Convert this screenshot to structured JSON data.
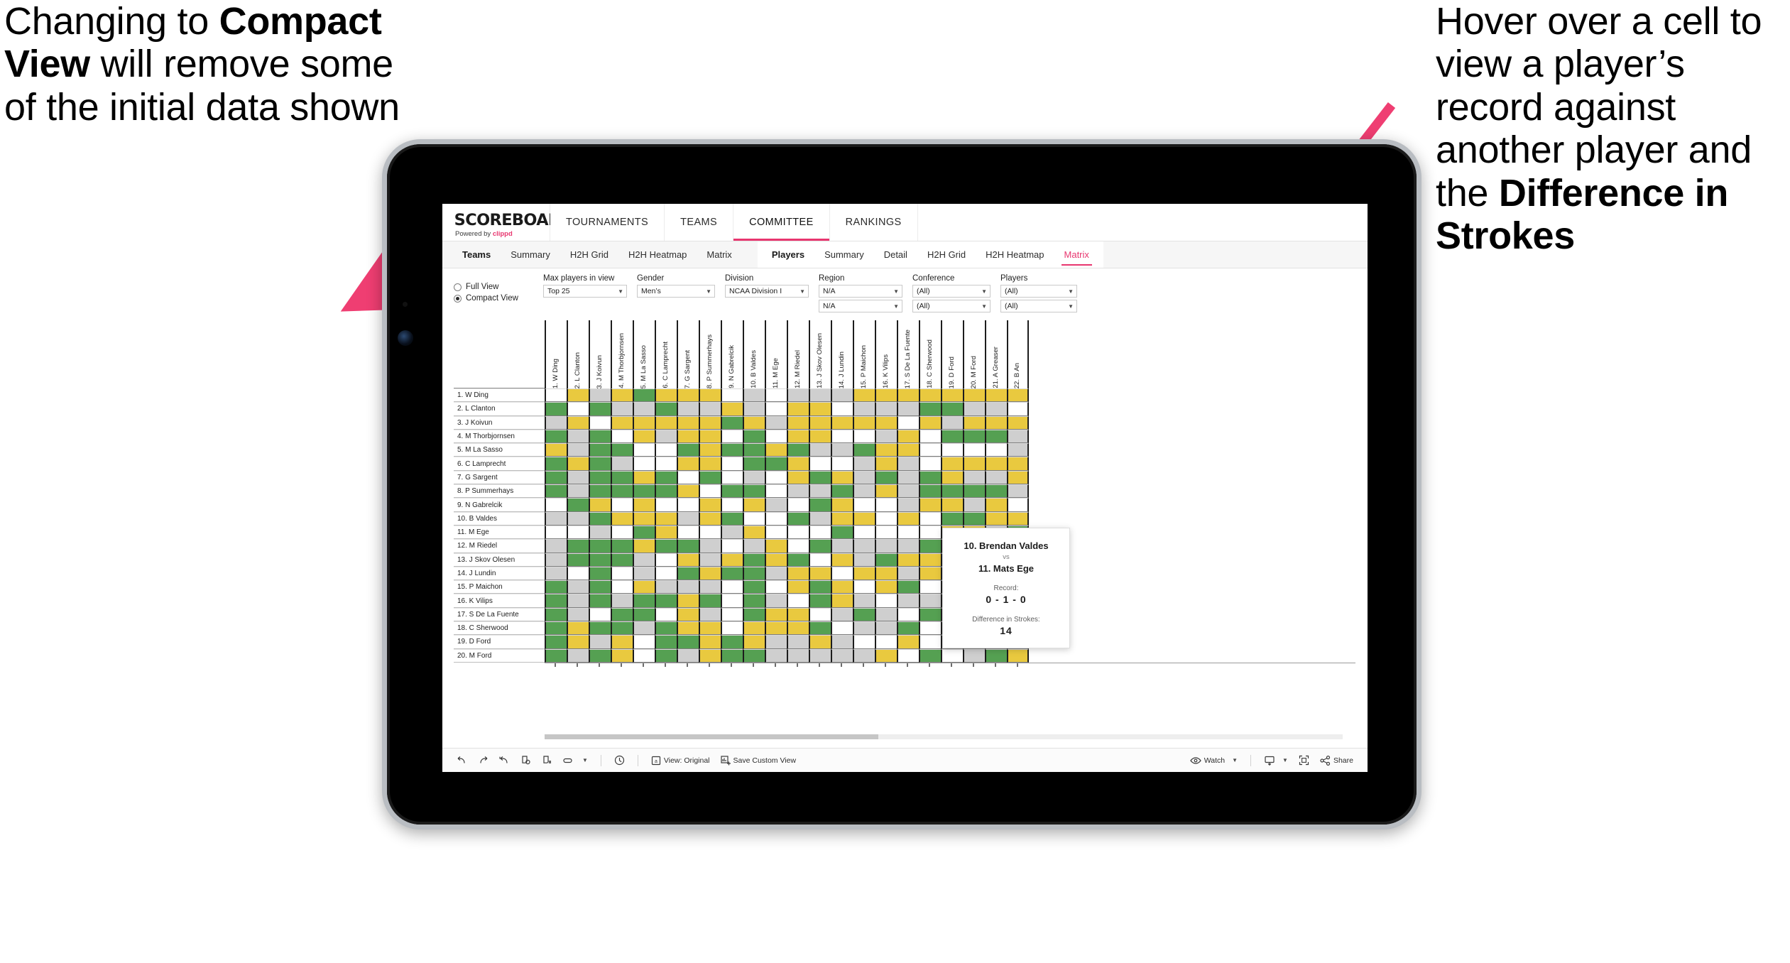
{
  "annotations": {
    "left": {
      "pre": "Changing to ",
      "bold": "Compact View",
      "post": " will remove some of the initial data shown"
    },
    "right": {
      "pre": "Hover over a cell to view a player’s record against another player and the ",
      "bold": "Difference in Strokes",
      "post": ""
    }
  },
  "brand": {
    "title": "SCOREBOARD",
    "powered_prefix": "Powered by ",
    "powered_name": "clippd"
  },
  "topnav": [
    {
      "label": "TOURNAMENTS",
      "active": false
    },
    {
      "label": "TEAMS",
      "active": false
    },
    {
      "label": "COMMITTEE",
      "active": true
    },
    {
      "label": "RANKINGS",
      "active": false
    }
  ],
  "subnav": {
    "group1": [
      {
        "label": "Teams",
        "head": true,
        "active": false
      },
      {
        "label": "Summary",
        "head": false,
        "active": false
      },
      {
        "label": "H2H Grid",
        "head": false,
        "active": false
      },
      {
        "label": "H2H Heatmap",
        "head": false,
        "active": false
      },
      {
        "label": "Matrix",
        "head": false,
        "active": false
      }
    ],
    "group2": [
      {
        "label": "Players",
        "head": true,
        "active": false
      },
      {
        "label": "Summary",
        "head": false,
        "active": false
      },
      {
        "label": "Detail",
        "head": false,
        "active": false
      },
      {
        "label": "H2H Grid",
        "head": false,
        "active": false
      },
      {
        "label": "H2H Heatmap",
        "head": false,
        "active": false
      },
      {
        "label": "Matrix",
        "head": false,
        "active": true
      }
    ]
  },
  "filters": {
    "view_mode": {
      "full_label": "Full View",
      "compact_label": "Compact View",
      "selected": "Compact View"
    },
    "max_players": {
      "label": "Max players in view",
      "value": "Top 25"
    },
    "gender": {
      "label": "Gender",
      "value": "Men’s"
    },
    "division": {
      "label": "Division",
      "value": "NCAA Division I"
    },
    "region": {
      "label": "Region",
      "value": "N/A",
      "value2": "N/A"
    },
    "conference": {
      "label": "Conference",
      "value": "(All)",
      "value2": "(All)"
    },
    "players": {
      "label": "Players",
      "value": "(All)",
      "value2": "(All)"
    }
  },
  "matrix": {
    "row_labels": [
      "1. W Ding",
      "2. L Clanton",
      "3. J Koivun",
      "4. M Thorbjornsen",
      "5. M La Sasso",
      "6. C Lamprecht",
      "7. G Sargent",
      "8. P Summerhays",
      "9. N Gabrelcik",
      "10. B Valdes",
      "11. M Ege",
      "12. M Riedel",
      "13. J Skov Olesen",
      "14. J Lundin",
      "15. P Maichon",
      "16. K Vilips",
      "17. S De La Fuente",
      "18. C Sherwood",
      "19. D Ford",
      "20. M Ford"
    ],
    "col_labels": [
      "1. W Ding",
      "2. L Clanton",
      "3. J Koivun",
      "4. M Thorbjornsen",
      "5. M La Sasso",
      "6. C Lamprecht",
      "7. G Sargent",
      "8. P Summerhays",
      "9. N Gabrelcik",
      "10. B Valdes",
      "11. M Ege",
      "12. M Riedel",
      "13. J Skov Olesen",
      "14. J Lundin",
      "15. P Maichon",
      "16. K Vilips",
      "17. S De La Fuente",
      "18. C Sherwood",
      "19. D Ford",
      "20. M Ford",
      "21. A Greaser",
      "22. B An"
    ],
    "legend": {
      "win": "#55a052",
      "tie": "#e9c93f",
      "loss": "#cfcfcf",
      "none": "#ffffff"
    },
    "cells": [
      [
        "w",
        "y",
        "a",
        "y",
        "g",
        "y",
        "y",
        "y",
        "w",
        "a",
        "w",
        "a",
        "a",
        "a",
        "y",
        "y",
        "y",
        "y",
        "y",
        "y",
        "y",
        "y"
      ],
      [
        "g",
        "w",
        "g",
        "a",
        "a",
        "g",
        "a",
        "a",
        "y",
        "a",
        "w",
        "y",
        "y",
        "w",
        "a",
        "a",
        "a",
        "g",
        "g",
        "a",
        "a",
        "w"
      ],
      [
        "a",
        "y",
        "w",
        "y",
        "y",
        "y",
        "y",
        "y",
        "g",
        "y",
        "a",
        "y",
        "y",
        "y",
        "y",
        "y",
        "w",
        "y",
        "a",
        "y",
        "y",
        "y"
      ],
      [
        "g",
        "a",
        "g",
        "w",
        "y",
        "a",
        "y",
        "y",
        "w",
        "g",
        "w",
        "y",
        "y",
        "w",
        "w",
        "a",
        "y",
        "w",
        "g",
        "g",
        "g",
        "a"
      ],
      [
        "y",
        "a",
        "g",
        "g",
        "w",
        "w",
        "g",
        "y",
        "g",
        "g",
        "y",
        "g",
        "a",
        "a",
        "g",
        "y",
        "y",
        "w",
        "w",
        "w",
        "w",
        "a"
      ],
      [
        "g",
        "y",
        "g",
        "a",
        "w",
        "w",
        "y",
        "y",
        "w",
        "g",
        "g",
        "y",
        "w",
        "w",
        "a",
        "y",
        "a",
        "w",
        "y",
        "y",
        "y",
        "y"
      ],
      [
        "g",
        "a",
        "g",
        "g",
        "y",
        "g",
        "w",
        "g",
        "w",
        "a",
        "w",
        "y",
        "g",
        "y",
        "a",
        "g",
        "a",
        "g",
        "y",
        "a",
        "a",
        "y"
      ],
      [
        "g",
        "a",
        "g",
        "g",
        "g",
        "g",
        "y",
        "w",
        "g",
        "g",
        "w",
        "a",
        "a",
        "g",
        "a",
        "y",
        "a",
        "g",
        "g",
        "g",
        "g",
        "a"
      ],
      [
        "w",
        "g",
        "y",
        "w",
        "y",
        "w",
        "w",
        "y",
        "w",
        "y",
        "a",
        "w",
        "g",
        "y",
        "w",
        "w",
        "a",
        "y",
        "y",
        "a",
        "y",
        "w"
      ],
      [
        "a",
        "a",
        "g",
        "y",
        "y",
        "y",
        "a",
        "y",
        "g",
        "w",
        "w",
        "g",
        "a",
        "y",
        "y",
        "w",
        "y",
        "w",
        "g",
        "g",
        "y",
        "y"
      ],
      [
        "w",
        "w",
        "a",
        "w",
        "g",
        "y",
        "w",
        "w",
        "a",
        "y",
        "w",
        "w",
        "w",
        "g",
        "w",
        "w",
        "w",
        "w",
        "y",
        "y",
        "a",
        "g"
      ],
      [
        "a",
        "g",
        "g",
        "g",
        "y",
        "g",
        "g",
        "a",
        "w",
        "a",
        "y",
        "w",
        "g",
        "a",
        "a",
        "a",
        "a",
        "g",
        "y",
        "w",
        "g",
        "y"
      ],
      [
        "a",
        "g",
        "g",
        "g",
        "a",
        "w",
        "y",
        "a",
        "y",
        "g",
        "y",
        "g",
        "w",
        "y",
        "a",
        "g",
        "y",
        "y",
        "y",
        "g",
        "a",
        "y"
      ],
      [
        "a",
        "w",
        "g",
        "w",
        "a",
        "w",
        "g",
        "y",
        "g",
        "g",
        "a",
        "y",
        "y",
        "w",
        "y",
        "y",
        "a",
        "y",
        "a",
        "y",
        "g",
        "a"
      ],
      [
        "g",
        "a",
        "g",
        "w",
        "y",
        "a",
        "a",
        "a",
        "w",
        "g",
        "w",
        "y",
        "g",
        "y",
        "w",
        "y",
        "g",
        "w",
        "y",
        "g",
        "a",
        "y"
      ],
      [
        "g",
        "a",
        "g",
        "a",
        "g",
        "g",
        "y",
        "g",
        "w",
        "g",
        "a",
        "w",
        "g",
        "y",
        "a",
        "w",
        "a",
        "a",
        "y",
        "g",
        "y",
        "g"
      ],
      [
        "g",
        "a",
        "w",
        "g",
        "g",
        "w",
        "y",
        "a",
        "w",
        "g",
        "y",
        "y",
        "w",
        "a",
        "g",
        "a",
        "w",
        "g",
        "y",
        "w",
        "g",
        "y"
      ],
      [
        "g",
        "y",
        "g",
        "g",
        "a",
        "g",
        "y",
        "y",
        "w",
        "y",
        "y",
        "y",
        "g",
        "w",
        "a",
        "a",
        "g",
        "w",
        "y",
        "y",
        "g",
        "g"
      ],
      [
        "g",
        "y",
        "a",
        "y",
        "w",
        "g",
        "g",
        "y",
        "g",
        "y",
        "a",
        "a",
        "y",
        "a",
        "w",
        "w",
        "y",
        "w",
        "w",
        "g",
        "y",
        "a"
      ],
      [
        "g",
        "a",
        "g",
        "y",
        "w",
        "g",
        "a",
        "y",
        "g",
        "g",
        "a",
        "a",
        "a",
        "a",
        "a",
        "y",
        "w",
        "g",
        "w",
        "a",
        "g",
        "y"
      ]
    ]
  },
  "tooltip": {
    "player_a": "10. Brendan Valdes",
    "vs": "vs",
    "player_b": "11. Mats Ege",
    "record_label": "Record:",
    "record_value": "0 - 1 - 0",
    "diff_label": "Difference in Strokes:",
    "diff_value": "14"
  },
  "toolbar": {
    "view_label": "View: Original",
    "save_label": "Save Custom View",
    "watch_label": "Watch",
    "share_label": "Share"
  }
}
